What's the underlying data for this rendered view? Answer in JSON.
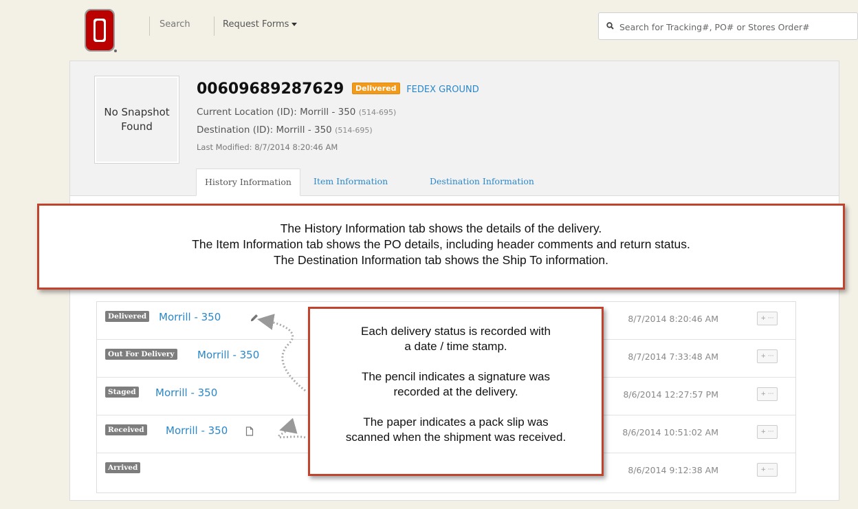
{
  "nav": {
    "search_label": "Search",
    "request_forms_label": "Request Forms",
    "tracking_search": {
      "placeholder": "Search for Tracking#, PO# or Stores Order#",
      "value": ""
    }
  },
  "shipment": {
    "snapshot_text": "No Snapshot Found",
    "tracking_number": "00609689287629",
    "status_badge": "Delivered",
    "carrier": "FEDEX GROUND",
    "current_location_label": "Current Location (ID):",
    "current_location": "Morrill - 350",
    "current_location_id": "(514-695)",
    "destination_label": "Destination (ID):",
    "destination": "Morrill - 350",
    "destination_id": "(514-695)",
    "last_modified": "Last Modified: 8/7/2014 8:20:46 AM"
  },
  "tabs": [
    {
      "label": "History Information",
      "active": true
    },
    {
      "label": "Item Information",
      "active": false
    },
    {
      "label": "Destination Information",
      "active": false
    }
  ],
  "history": [
    {
      "status": "Delivered",
      "location": "Morrill - 350",
      "timestamp": "8/7/2014 8:20:46 AM",
      "icon": "pencil-icon"
    },
    {
      "status": "Out For Delivery",
      "location": "Morrill - 350",
      "timestamp": "8/7/2014 7:33:48 AM",
      "icon": ""
    },
    {
      "status": "Staged",
      "location": "Morrill - 350",
      "timestamp": "8/6/2014 12:27:57 PM",
      "icon": ""
    },
    {
      "status": "Received",
      "location": "Morrill - 350",
      "timestamp": "8/6/2014 10:51:02 AM",
      "icon": "document-icon"
    },
    {
      "status": "Arrived",
      "location": "",
      "timestamp": "8/6/2014 9:12:38 AM",
      "icon": ""
    }
  ],
  "row_button_label": "+ ···",
  "callouts": {
    "tabs_note": [
      "The History Information tab shows the details of the delivery.",
      "The Item Information tab shows the PO details, including header comments and return status.",
      "The Destination Information tab shows the Ship To information."
    ],
    "status_note": [
      "Each delivery status is recorded with",
      "a date / time stamp.",
      "The pencil indicates a signature was",
      "recorded at the delivery.",
      "The paper indicates a pack slip was",
      "scanned when the shipment was received."
    ]
  },
  "colors": {
    "accent": "#2a87c8",
    "delivered_badge": "#f09a1e",
    "status_badge": "#7d7d7d",
    "callout_border": "#c0432e",
    "logo_red": "#bb0000"
  }
}
